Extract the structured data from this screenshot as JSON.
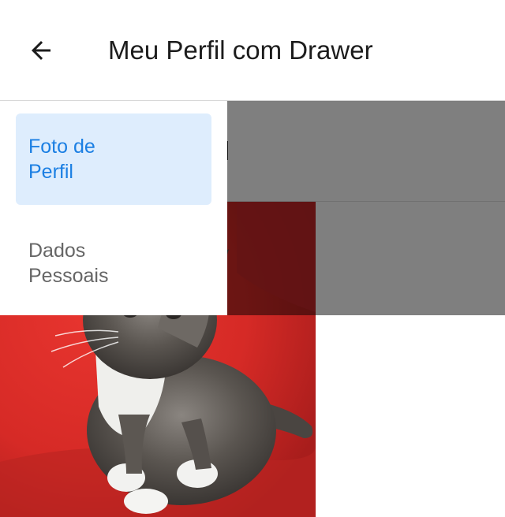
{
  "appbar": {
    "title": "Meu Perfil com Drawer",
    "back_icon": "arrow-left-icon"
  },
  "content": {
    "visible_title_fragment": "erfil",
    "photo": "kitten-on-red-chair"
  },
  "drawer": {
    "items": [
      {
        "label_line1": "Foto de",
        "label_line2": "Perfil",
        "active": true
      },
      {
        "label_line1": "Dados",
        "label_line2": "Pessoais",
        "active": false
      }
    ]
  },
  "colors": {
    "accent": "#1b7fe3",
    "active_bg": "#deedfd",
    "inactive_text": "#666666",
    "scrim": "rgba(0,0,0,0.5)"
  }
}
